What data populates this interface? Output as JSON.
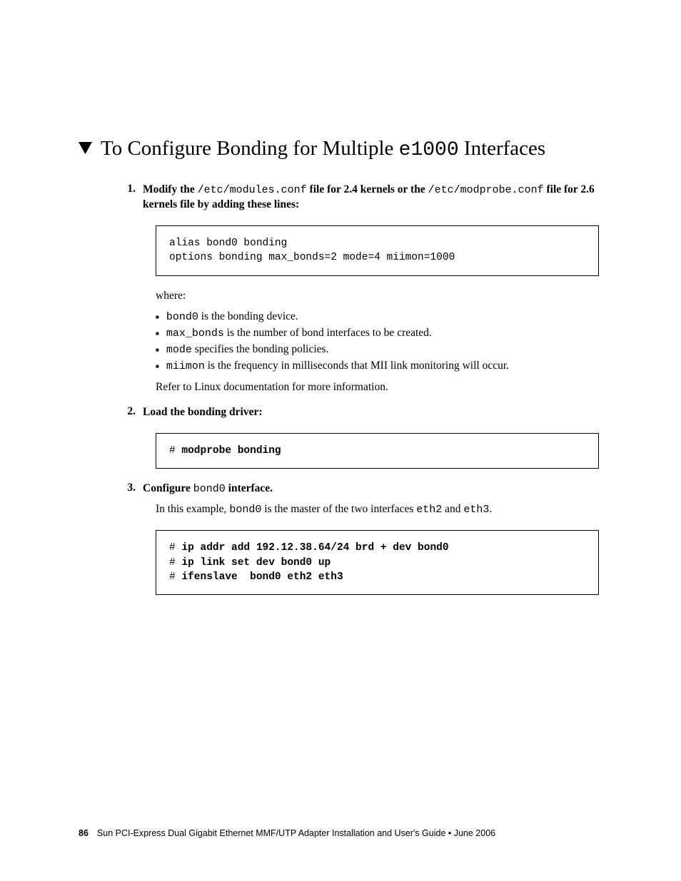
{
  "heading": {
    "pre": "To Configure Bonding for Multiple ",
    "mono": "e1000",
    "post": " Interfaces"
  },
  "step1": {
    "num": "1.",
    "t1": "Modify the ",
    "t2": "/etc/modules.conf",
    "t3": " file for 2.4 kernels or the ",
    "t4": "/etc/modprobe.conf",
    "t5": " file for 2.6 kernels file by adding these lines:"
  },
  "code1": "alias bond0 bonding\noptions bonding max_bonds=2 mode=4 miimon=1000",
  "where": "where:",
  "bullets": {
    "b1_mono": "bond0",
    "b1_rest": " is the bonding device.",
    "b2_mono": "max_bonds",
    "b2_rest": " is the number of bond interfaces to be created.",
    "b3_mono": "mode",
    "b3_rest": " specifies the bonding policies.",
    "b4_mono": "miimon",
    "b4_rest": " is the frequency in milliseconds that MII link monitoring will occur."
  },
  "refer": "Refer to Linux documentation for more information.",
  "step2": {
    "num": "2.",
    "t1": "Load the bonding driver:"
  },
  "code2_hash": "# ",
  "code2_cmd": "modprobe bonding",
  "step3": {
    "num": "3.",
    "t1": "Configure ",
    "t2": "bond0",
    "t3": " interface."
  },
  "example": {
    "p1": "In this example, ",
    "m1": "bond0",
    "p2": " is the master of the two interfaces ",
    "m2": "eth2",
    "p3": " and ",
    "m3": "eth3",
    "p4": "."
  },
  "code3_h1": "# ",
  "code3_c1": "ip addr add 192.12.38.64/24 brd + dev bond0",
  "code3_h2": "# ",
  "code3_c2": "ip link set dev bond0 up",
  "code3_h3": "# ",
  "code3_c3": "ifenslave  bond0 eth2 eth3",
  "footer": {
    "page": "86",
    "title": "Sun PCI-Express Dual Gigabit Ethernet MMF/UTP Adapter Installation and User's Guide  •  June 2006"
  }
}
